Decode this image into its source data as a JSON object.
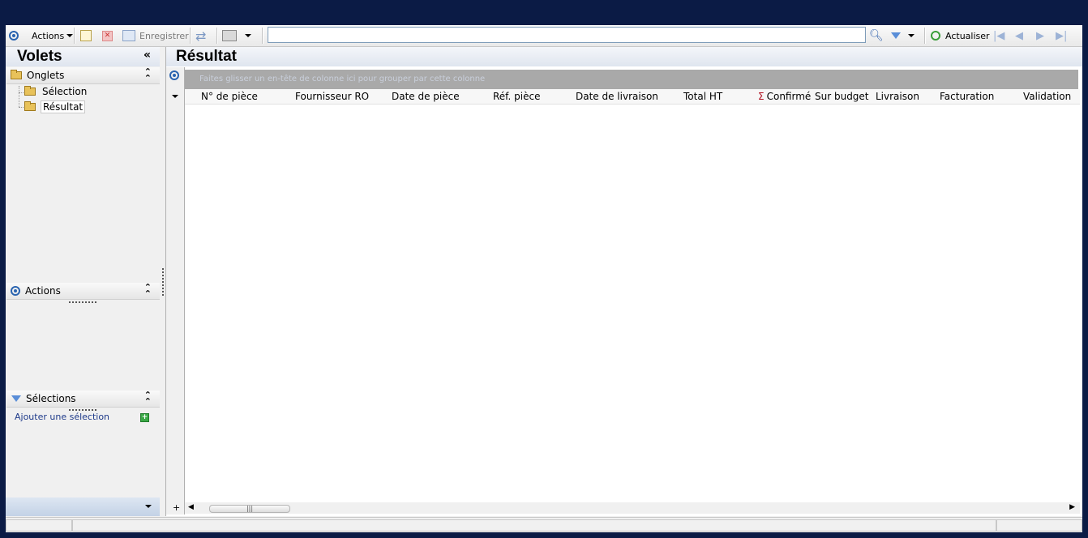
{
  "toolbar": {
    "actions_label": "Actions",
    "save_label": "Enregistrer",
    "search_value": "",
    "refresh_label": "Actualiser"
  },
  "left_panel": {
    "title": "Volets",
    "collapse_glyph": "«",
    "tabs_section": {
      "title": "Onglets",
      "items": [
        {
          "label": "Sélection"
        },
        {
          "label": "Résultat",
          "selected": true
        }
      ]
    },
    "actions_section": {
      "title": "Actions"
    },
    "selections_section": {
      "title": "Sélections",
      "add_link": "Ajouter une sélection"
    }
  },
  "result_panel": {
    "title": "Résultat",
    "group_hint": "Faites glisser un en-tête de colonne ici pour grouper par cette colonne",
    "columns": [
      "N° de pièce",
      "Fournisseur RO",
      "Date de pièce",
      "Réf. pièce",
      "Date de livraison",
      "Total HT",
      "Confirmé",
      "Sur budget",
      "Livraison",
      "Facturation",
      "Validation"
    ]
  },
  "icons": [
    "actions-circle-icon",
    "new-icon",
    "delete-icon",
    "save-icon",
    "sync-icon",
    "print-icon",
    "search-icon",
    "filter-icon",
    "refresh-icon",
    "first-icon",
    "prev-icon",
    "next-icon",
    "last-icon",
    "folder-icon",
    "sigma-icon",
    "add-icon"
  ],
  "colors": {
    "background": "#0b1b45",
    "header": "#dfe5ef",
    "accent": "#2a64b0"
  }
}
